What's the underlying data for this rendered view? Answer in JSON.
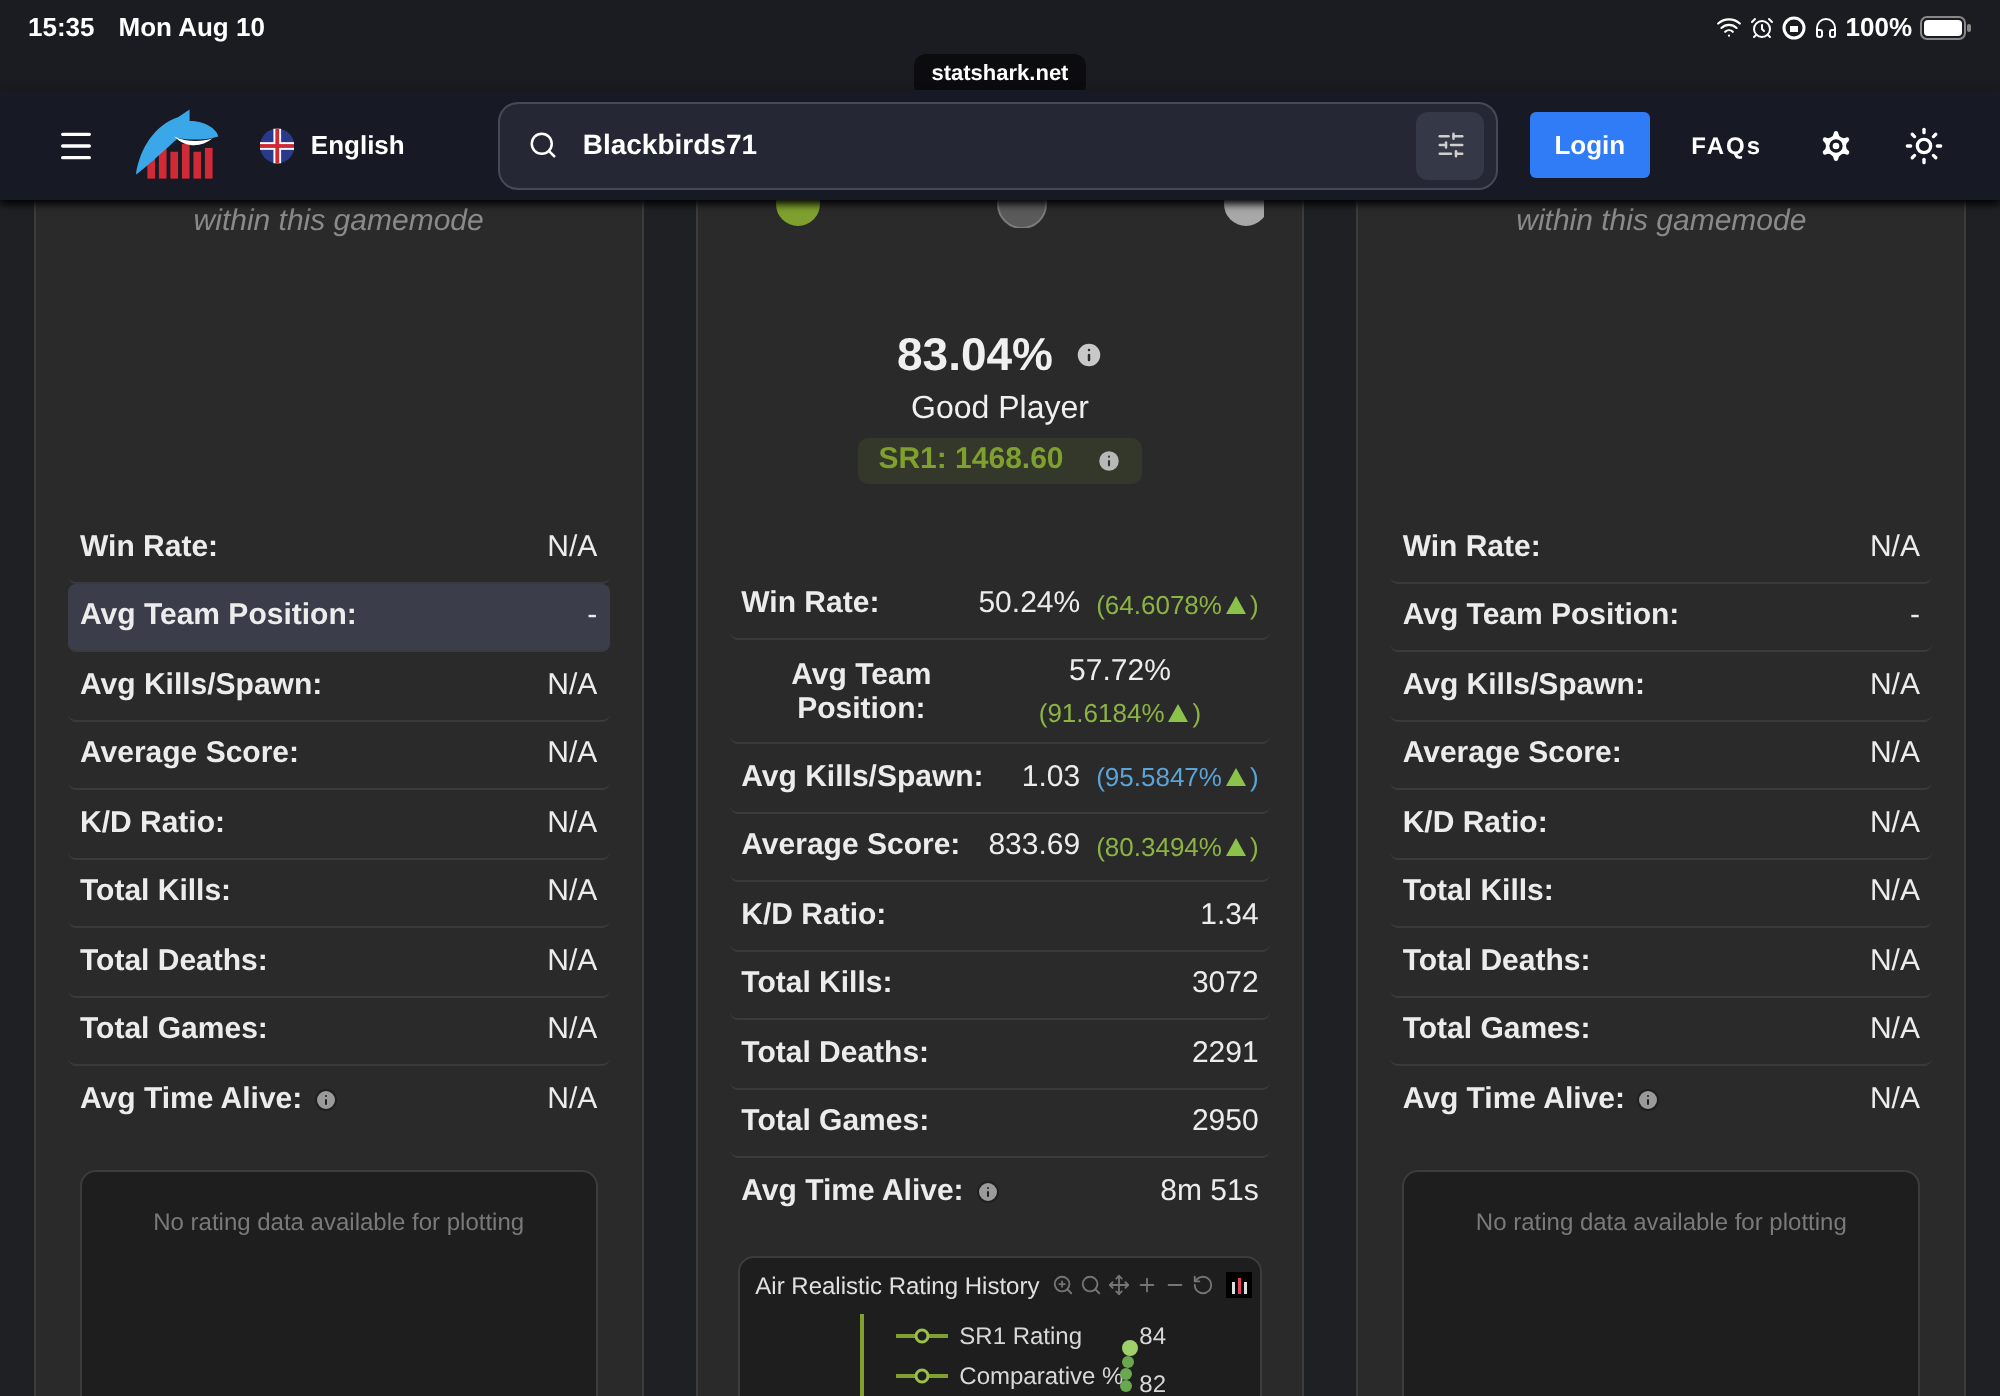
{
  "status_bar": {
    "time": "15:35",
    "date": "Mon Aug 10",
    "battery": "100%",
    "url": "statshark.net"
  },
  "nav": {
    "language": "English",
    "search": {
      "value": "Blackbirds71"
    },
    "login": "Login",
    "faqs": "FAQs"
  },
  "columns": [
    {
      "kind": "empty",
      "note": "within this gamemode",
      "rows": [
        {
          "label": "Win Rate:",
          "value": "N/A",
          "info": false,
          "selected": false
        },
        {
          "label": "Avg Team Position:",
          "value": "-",
          "info": false,
          "selected": true
        },
        {
          "label": "Avg Kills/Spawn:",
          "value": "N/A",
          "info": false,
          "selected": false
        },
        {
          "label": "Average Score:",
          "value": "N/A",
          "info": false,
          "selected": false
        },
        {
          "label": "K/D Ratio:",
          "value": "N/A",
          "info": false,
          "selected": false
        },
        {
          "label": "Total Kills:",
          "value": "N/A",
          "info": false,
          "selected": false
        },
        {
          "label": "Total Deaths:",
          "value": "N/A",
          "info": false,
          "selected": false
        },
        {
          "label": "Total Games:",
          "value": "N/A",
          "info": false,
          "selected": false
        },
        {
          "label": "Avg Time Alive:",
          "value": "N/A",
          "info": true,
          "selected": false
        }
      ],
      "plot_message": "No rating data available for plotting"
    },
    {
      "kind": "rated",
      "score": "83.04%",
      "rank": "Good Player",
      "sr": "SR1: 1468.60",
      "rows": [
        {
          "label": "Win Rate:",
          "value": "50.24%",
          "percentile": {
            "text": "(64.6078%",
            "close": ")",
            "color": "#8bb443"
          },
          "info": false,
          "selected": false
        },
        {
          "label": "Avg Team Position:",
          "value": "57.72%",
          "percentile": {
            "text": "(91.6184%",
            "close": ")",
            "color": "#8bb443"
          },
          "info": false,
          "selected": false,
          "stacked": true
        },
        {
          "label": "Avg Kills/Spawn:",
          "value": "1.03",
          "percentile": {
            "text": "(95.5847%",
            "close": ")",
            "color": "#5aa4d8"
          },
          "info": false,
          "selected": false
        },
        {
          "label": "Average Score:",
          "value": "833.69",
          "percentile": {
            "text": "(80.3494%",
            "close": ")",
            "color": "#8bb443"
          },
          "info": false,
          "selected": false
        },
        {
          "label": "K/D Ratio:",
          "value": "1.34",
          "info": false,
          "selected": false
        },
        {
          "label": "Total Kills:",
          "value": "3072",
          "info": false,
          "selected": false
        },
        {
          "label": "Total Deaths:",
          "value": "2291",
          "info": false,
          "selected": false
        },
        {
          "label": "Total Games:",
          "value": "2950",
          "info": false,
          "selected": false
        },
        {
          "label": "Avg Time Alive:",
          "value": "8m 51s",
          "info": true,
          "selected": false
        }
      ],
      "chart": {
        "title": "Air Realistic Rating History",
        "legend": [
          "SR1 Rating",
          "Comparative %"
        ],
        "tick_labels": [
          "84",
          "82"
        ]
      }
    },
    {
      "kind": "empty",
      "note": "within this gamemode",
      "rows": [
        {
          "label": "Win Rate:",
          "value": "N/A",
          "info": false,
          "selected": false
        },
        {
          "label": "Avg Team Position:",
          "value": "-",
          "info": false,
          "selected": false
        },
        {
          "label": "Avg Kills/Spawn:",
          "value": "N/A",
          "info": false,
          "selected": false
        },
        {
          "label": "Average Score:",
          "value": "N/A",
          "info": false,
          "selected": false
        },
        {
          "label": "K/D Ratio:",
          "value": "N/A",
          "info": false,
          "selected": false
        },
        {
          "label": "Total Kills:",
          "value": "N/A",
          "info": false,
          "selected": false
        },
        {
          "label": "Total Deaths:",
          "value": "N/A",
          "info": false,
          "selected": false
        },
        {
          "label": "Total Games:",
          "value": "N/A",
          "info": false,
          "selected": false
        },
        {
          "label": "Avg Time Alive:",
          "value": "N/A",
          "info": true,
          "selected": false
        }
      ],
      "plot_message": "No rating data available for plotting"
    }
  ]
}
